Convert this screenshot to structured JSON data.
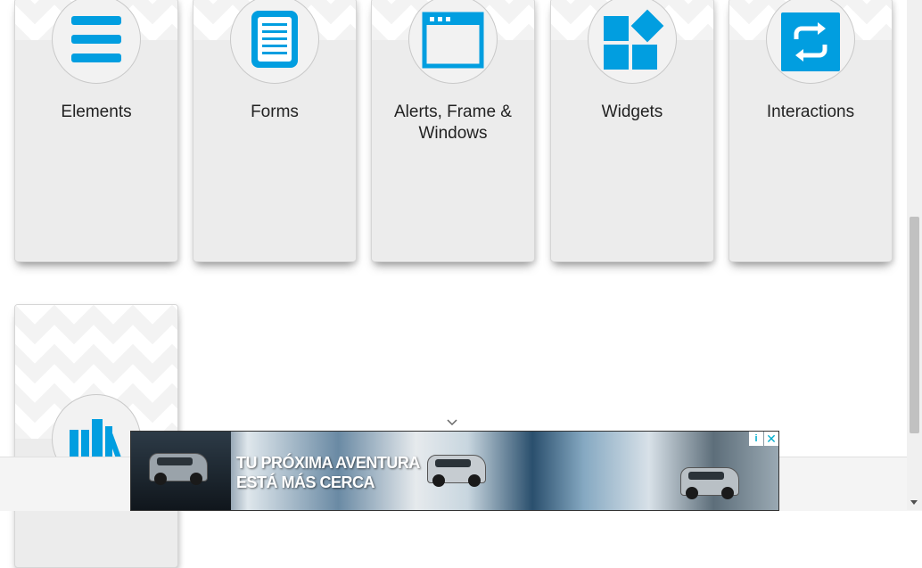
{
  "cards": [
    {
      "title": "Elements",
      "icon": "list-icon"
    },
    {
      "title": "Forms",
      "icon": "form-icon"
    },
    {
      "title": "Alerts, Frame & Windows",
      "icon": "browser-window-icon"
    },
    {
      "title": "Widgets",
      "icon": "widgets-icon"
    },
    {
      "title": "Interactions",
      "icon": "interactions-icon"
    },
    {
      "title": "",
      "icon": "books-icon"
    }
  ],
  "ad": {
    "text_line1": "TU PRÓXIMA AVENTURA",
    "text_line2": "ESTÁ MÁS CERCA",
    "close_label": "✕",
    "info_label": "i"
  },
  "colors": {
    "accent": "#019ee0",
    "card_bg": "#ececec"
  }
}
